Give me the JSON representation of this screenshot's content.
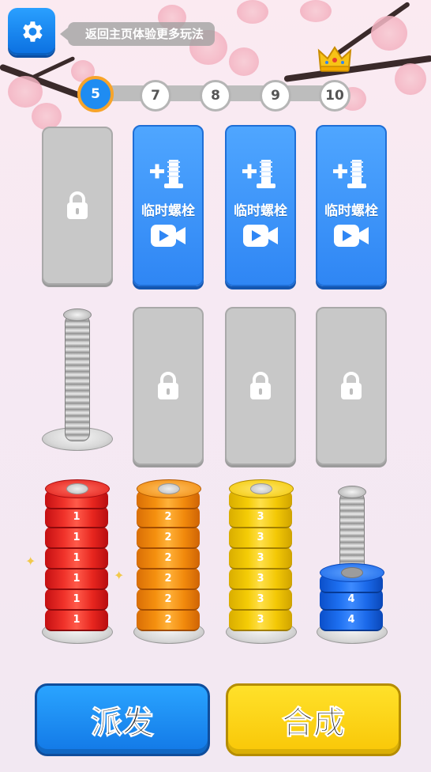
{
  "header": {
    "settings_icon": "gear-icon",
    "tip_text": "返回主页体验更多玩法"
  },
  "levels": {
    "items": [
      "5",
      "7",
      "8",
      "9",
      "10"
    ],
    "current": "5",
    "final_icon": "crown-icon"
  },
  "slots": {
    "row1": [
      {
        "state": "locked",
        "icon": "lock-icon"
      },
      {
        "state": "ad",
        "label": "临时螺栓",
        "icon": "add-bolt-icon",
        "ad_icon": "video-icon"
      },
      {
        "state": "ad",
        "label": "临时螺栓",
        "icon": "add-bolt-icon",
        "ad_icon": "video-icon"
      },
      {
        "state": "ad",
        "label": "临时螺栓",
        "icon": "add-bolt-icon",
        "ad_icon": "video-icon"
      }
    ],
    "row2": [
      {
        "state": "empty-bolt"
      },
      {
        "state": "locked",
        "icon": "lock-icon"
      },
      {
        "state": "locked",
        "icon": "lock-icon"
      },
      {
        "state": "locked",
        "icon": "lock-icon"
      }
    ]
  },
  "stacks": [
    {
      "color": "red",
      "labels": [
        "1",
        "1",
        "1",
        "1",
        "1",
        "1"
      ]
    },
    {
      "color": "orange",
      "labels": [
        "2",
        "2",
        "2",
        "2",
        "2",
        "2"
      ]
    },
    {
      "color": "yellow",
      "labels": [
        "3",
        "3",
        "3",
        "3",
        "3",
        "3"
      ]
    },
    {
      "color": "blue",
      "labels": [
        "4",
        "4"
      ]
    }
  ],
  "buttons": {
    "dispatch": "派发",
    "merge": "合成"
  }
}
